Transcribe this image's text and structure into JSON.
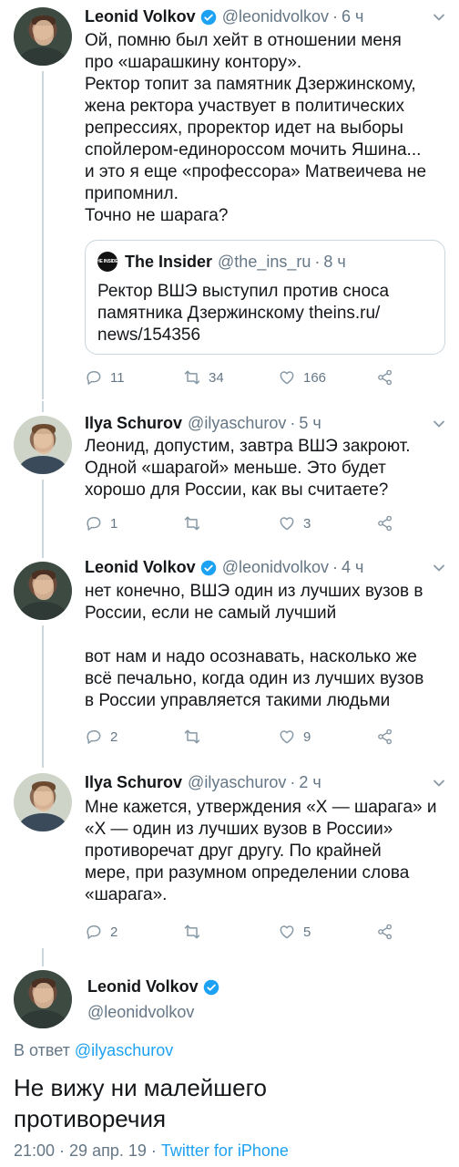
{
  "colors": {
    "accent": "#1da1f2",
    "muted": "#657786",
    "text": "#14171a",
    "line": "#ccd6dd"
  },
  "tweets": [
    {
      "name": "Leonid Volkov",
      "verified": true,
      "handle": "@leonidvolkov",
      "time": "6 ч",
      "text": "Ой, помню был хейт в отношении меня\nпро «шарашкину контору».\nРектор топит за памятник Дзержинскому,\nжена ректора участвует в политических\nрепрессиях, проректор идет на выборы\nспойлером-единороссом мочить Яшина...\nи это я еще «профессора» Матвеичева не\nприпомнил.\nТочно не шарага?",
      "quote": {
        "logo_text": "THE INSIDER",
        "name": "The Insider",
        "handle": "@the_ins_ru",
        "time": "8 ч",
        "text": "Ректор ВШЭ выступил против сноса\nпамятника Дзержинскому theins.ru/\nnews/154356"
      },
      "replies": "11",
      "retweets": "34",
      "likes": "166"
    },
    {
      "name": "Ilya Schurov",
      "verified": false,
      "handle": "@ilyaschurov",
      "time": "5 ч",
      "text": "Леонид, допустим, завтра ВШЭ закроют.\nОдной «шарагой» меньше. Это будет\nхорошо для России, как вы считаете?",
      "replies": "1",
      "retweets": "",
      "likes": "3"
    },
    {
      "name": "Leonid Volkov",
      "verified": true,
      "handle": "@leonidvolkov",
      "time": "4 ч",
      "text": "нет конечно, ВШЭ один из лучших вузов в\nРоссии, если не самый лучший\n\nвот нам и надо осознавать, насколько же\nвсё печально, когда один из лучших вузов\nв России управляется такими людьми",
      "replies": "2",
      "retweets": "",
      "likes": "9"
    },
    {
      "name": "Ilya Schurov",
      "verified": false,
      "handle": "@ilyaschurov",
      "time": "2 ч",
      "text": "Мне кажется, утверждения «X — шарага» и\n«X — один из лучших вузов в России»\nпротиворечат друг другу. По крайней\nмере, при разумном определении слова\n«шарага».",
      "replies": "2",
      "retweets": "",
      "likes": "5"
    }
  ],
  "main": {
    "name": "Leonid Volkov",
    "handle": "@leonidvolkov",
    "reply_prefix": "В ответ",
    "reply_to": "@ilyaschurov",
    "text": "Не вижу ни малейшего\nпротиворечия",
    "date": "21:00 · 29 апр. 19 · ",
    "client": "Twitter for iPhone"
  }
}
